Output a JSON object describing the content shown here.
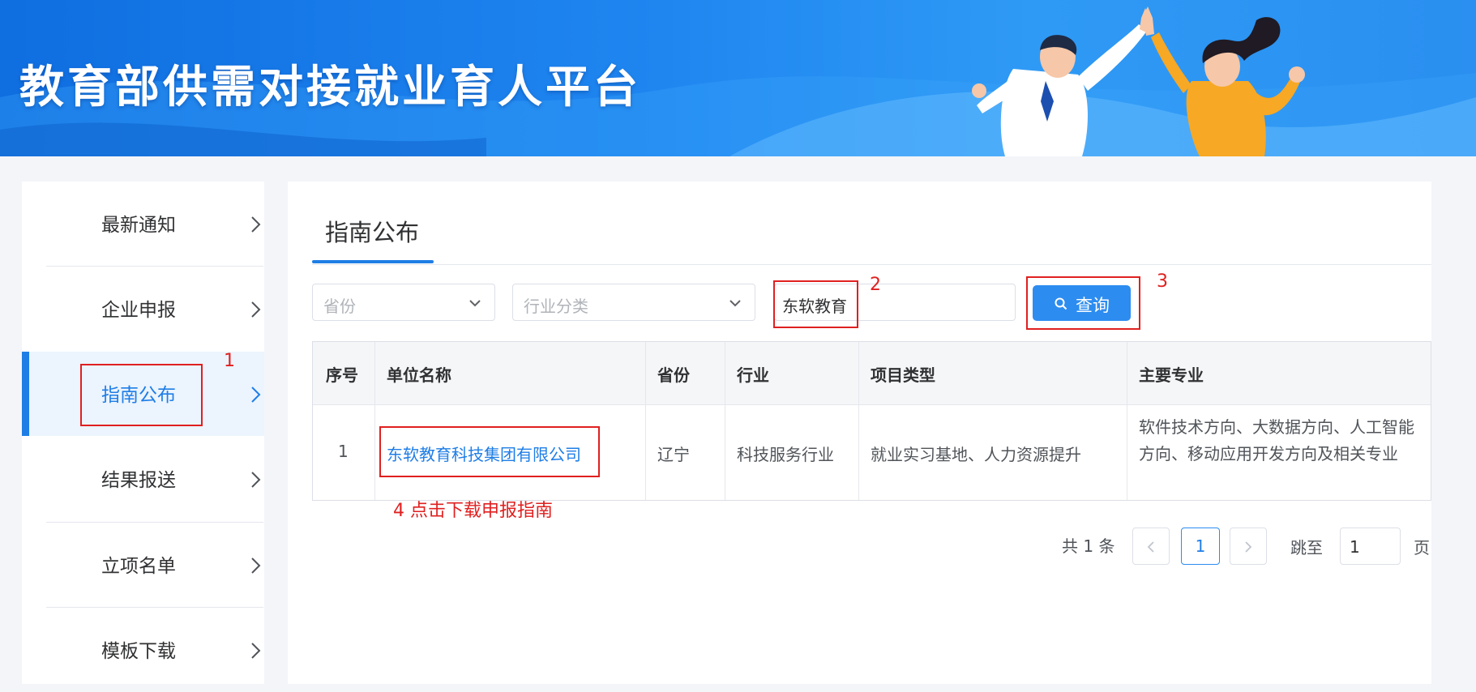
{
  "header": {
    "title": "教育部供需对接就业育人平台"
  },
  "sidebar": {
    "items": [
      {
        "label": "最新通知"
      },
      {
        "label": "企业申报"
      },
      {
        "label": "指南公布"
      },
      {
        "label": "结果报送"
      },
      {
        "label": "立项名单"
      },
      {
        "label": "模板下载"
      }
    ],
    "active_index": 2
  },
  "main": {
    "tab_title": "指南公布",
    "filters": {
      "province_placeholder": "省份",
      "industry_placeholder": "行业分类",
      "keyword_value": "东软教育"
    },
    "query_button": "查询",
    "table": {
      "headers": [
        "序号",
        "单位名称",
        "省份",
        "行业",
        "项目类型",
        "主要专业"
      ],
      "rows": [
        {
          "index": "1",
          "company": "东软教育科技集团有限公司",
          "province": "辽宁",
          "industry": "科技服务行业",
          "project_type": "就业实习基地、人力资源提升",
          "majors": "软件技术方向、大数据方向、人工智能方向、移动应用开发方向及相关专业"
        }
      ]
    },
    "pagination": {
      "total_text": "共 1 条",
      "current_page": "1",
      "jump_label": "跳至",
      "jump_value": "1",
      "unit": "页"
    }
  },
  "annotations": {
    "num1": "1",
    "num2": "2",
    "num3": "3",
    "note4": "4 点击下载申报指南"
  },
  "colors": {
    "primary": "#1f7ee6",
    "button": "#2d8cf0",
    "annotation": "#e02020"
  }
}
